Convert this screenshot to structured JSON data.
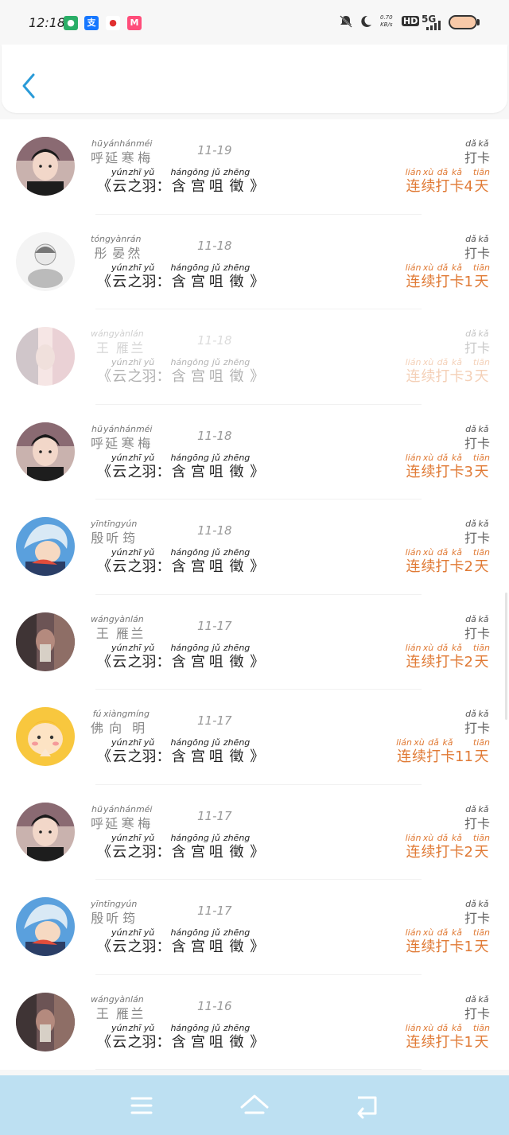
{
  "status_bar": {
    "time": "12:18",
    "apps": [
      {
        "icon": "wechat-icon",
        "color": "#2aae67",
        "glyph": "●"
      },
      {
        "icon": "alipay-icon",
        "color": "#1677ff",
        "glyph": "支"
      },
      {
        "icon": "location-icon",
        "color": "#e02f2f",
        "glyph": "📍"
      },
      {
        "icon": "app-icon",
        "color": "#ff4d7a",
        "glyph": "M"
      }
    ],
    "speed_value": "0.70",
    "speed_unit": "KB/s",
    "hd": "HD",
    "network": "5G"
  },
  "header": {
    "back_label": "back"
  },
  "rows": [
    {
      "name_py": [
        "hū",
        "yán",
        "hán",
        "méi"
      ],
      "name": [
        "呼",
        "延",
        "寒",
        "梅"
      ],
      "date": "11-19",
      "avatar": "boy",
      "faded": false,
      "streak_py": [
        "lián",
        "xù",
        "dǎ",
        "kǎ",
        "",
        "tiān"
      ],
      "streak": [
        "连",
        "续",
        "打",
        "卡",
        "4",
        "天"
      ]
    },
    {
      "name_py": [
        "tóng",
        "yàn",
        "rán"
      ],
      "name": [
        "彤",
        "晏",
        "然"
      ],
      "date": "11-18",
      "avatar": "girl-sketch",
      "faded": false,
      "streak_py": [
        "lián",
        "xù",
        "dǎ",
        "kǎ",
        "",
        "tiān"
      ],
      "streak": [
        "连",
        "续",
        "打",
        "卡",
        "1",
        "天"
      ]
    },
    {
      "name_py": [
        "wáng",
        "yàn",
        "lán"
      ],
      "name": [
        "王",
        "雁",
        "兰"
      ],
      "date": "11-18",
      "avatar": "photo-pink",
      "faded": true,
      "streak_py": [
        "lián",
        "xù",
        "dǎ",
        "kǎ",
        "",
        "tiān"
      ],
      "streak": [
        "连",
        "续",
        "打",
        "卡",
        "3",
        "天"
      ]
    },
    {
      "name_py": [
        "hū",
        "yán",
        "hán",
        "méi"
      ],
      "name": [
        "呼",
        "延",
        "寒",
        "梅"
      ],
      "date": "11-18",
      "avatar": "boy",
      "faded": false,
      "streak_py": [
        "lián",
        "xù",
        "dǎ",
        "kǎ",
        "",
        "tiān"
      ],
      "streak": [
        "连",
        "续",
        "打",
        "卡",
        "3",
        "天"
      ]
    },
    {
      "name_py": [
        "yīn",
        "tīng",
        "yún"
      ],
      "name": [
        "殷",
        "听",
        "筠"
      ],
      "date": "11-18",
      "avatar": "anime-blue",
      "faded": false,
      "streak_py": [
        "lián",
        "xù",
        "dǎ",
        "kǎ",
        "",
        "tiān"
      ],
      "streak": [
        "连",
        "续",
        "打",
        "卡",
        "2",
        "天"
      ]
    },
    {
      "name_py": [
        "wáng",
        "yàn",
        "lán"
      ],
      "name": [
        "王",
        "雁",
        "兰"
      ],
      "date": "11-17",
      "avatar": "photo-dark",
      "faded": false,
      "streak_py": [
        "lián",
        "xù",
        "dǎ",
        "kǎ",
        "",
        "tiān"
      ],
      "streak": [
        "连",
        "续",
        "打",
        "卡",
        "2",
        "天"
      ]
    },
    {
      "name_py": [
        "fú",
        "xiàng",
        "míng"
      ],
      "name": [
        "佛",
        "向",
        "明"
      ],
      "date": "11-17",
      "avatar": "cartoon-yellow",
      "faded": false,
      "streak_py": [
        "lián",
        "xù",
        "dǎ",
        "kǎ",
        "",
        "tiān"
      ],
      "streak": [
        "连",
        "续",
        "打",
        "卡",
        "11",
        "天"
      ]
    },
    {
      "name_py": [
        "hū",
        "yán",
        "hán",
        "méi"
      ],
      "name": [
        "呼",
        "延",
        "寒",
        "梅"
      ],
      "date": "11-17",
      "avatar": "boy",
      "faded": false,
      "streak_py": [
        "lián",
        "xù",
        "dǎ",
        "kǎ",
        "",
        "tiān"
      ],
      "streak": [
        "连",
        "续",
        "打",
        "卡",
        "2",
        "天"
      ]
    },
    {
      "name_py": [
        "yīn",
        "tīng",
        "yún"
      ],
      "name": [
        "殷",
        "听",
        "筠"
      ],
      "date": "11-17",
      "avatar": "anime-blue",
      "faded": false,
      "streak_py": [
        "lián",
        "xù",
        "dǎ",
        "kǎ",
        "",
        "tiān"
      ],
      "streak": [
        "连",
        "续",
        "打",
        "卡",
        "1",
        "天"
      ]
    },
    {
      "name_py": [
        "wáng",
        "yàn",
        "lán"
      ],
      "name": [
        "王",
        "雁",
        "兰"
      ],
      "date": "11-16",
      "avatar": "photo-dark",
      "faded": false,
      "streak_py": [
        "lián",
        "xù",
        "dǎ",
        "kǎ",
        "",
        "tiān"
      ],
      "streak": [
        "连",
        "续",
        "打",
        "卡",
        "1",
        "天"
      ]
    }
  ],
  "common": {
    "open_bracket": "《",
    "close_bracket": "》",
    "title_py": [
      "yún",
      "zhī",
      "yǔ",
      "",
      "hán",
      "gōng",
      "jǔ",
      "zhēng"
    ],
    "title": [
      "云",
      "之",
      "羽",
      "：",
      "含",
      "宫",
      "咀",
      "徵"
    ],
    "checkin_py": [
      "dǎ",
      "kǎ"
    ],
    "checkin": [
      "打",
      "卡"
    ]
  },
  "nav": {
    "menu": "menu-icon",
    "home": "home-icon",
    "back": "return-icon"
  },
  "colors": {
    "accent": "#e07a35",
    "back_arrow": "#2a9bd8",
    "nav_bar": "#bde0f2"
  }
}
